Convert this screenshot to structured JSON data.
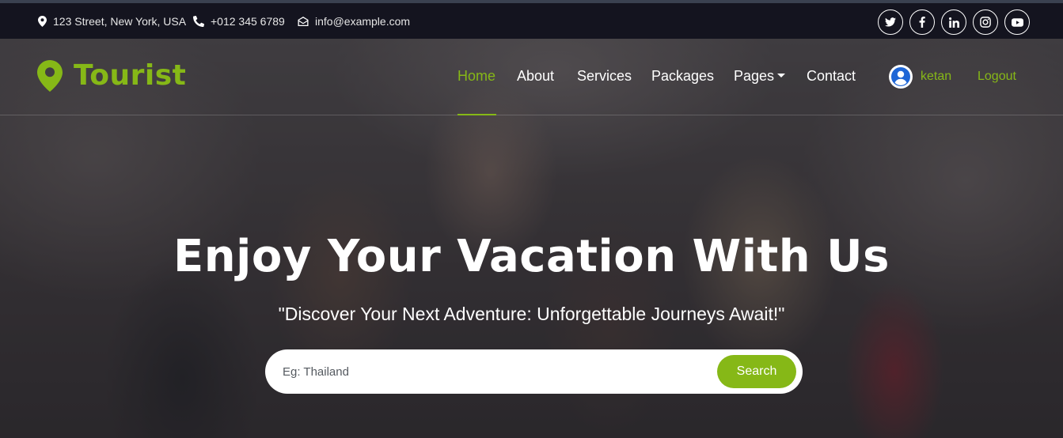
{
  "topbar": {
    "address": "123 Street, New York, USA",
    "phone": "+012 345 6789",
    "email": "info@example.com",
    "social_icons": [
      "twitter-icon",
      "facebook-icon",
      "linkedin-icon",
      "instagram-icon",
      "youtube-icon"
    ]
  },
  "brand": {
    "name": "Tourist",
    "icon": "map-marker-icon"
  },
  "nav": {
    "items": [
      {
        "label": "Home",
        "active": true
      },
      {
        "label": "About"
      },
      {
        "label": "Services"
      },
      {
        "label": "Packages"
      },
      {
        "label": "Pages",
        "dropdown": true
      },
      {
        "label": "Contact"
      }
    ],
    "user_name": "ketan",
    "logout": "Logout"
  },
  "hero": {
    "headline": "Enjoy Your Vacation With Us",
    "tagline": "\"Discover Your Next Adventure: Unforgettable Journeys Await!\""
  },
  "search": {
    "placeholder": "Eg: Thailand",
    "button": "Search"
  },
  "colors": {
    "accent": "#86b817",
    "topbar_bg": "#14141f"
  }
}
